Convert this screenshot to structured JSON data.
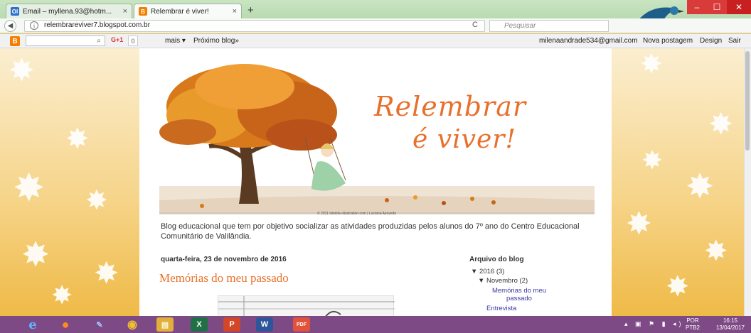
{
  "browser": {
    "tabs": [
      {
        "label": "Email – myllena.93@hotm...",
        "close": "×",
        "favicon": "Ol",
        "favicon_color": "#2a6fc9"
      },
      {
        "label": "Relembrar é viver!",
        "close": "×",
        "favicon": "B",
        "favicon_color": "#f57d00"
      }
    ],
    "new_tab": "+",
    "url": "relembrareviver7.blogspot.com.br",
    "search_placeholder": "Pesquisar",
    "window_controls": {
      "minimize": "–",
      "maximize": "☐",
      "close": "✕"
    }
  },
  "blogger_bar": {
    "logo": "B",
    "gplus": "G+1",
    "gplus_count": "0",
    "more": "mais ▾",
    "next_blog": "Próximo blog»",
    "email": "milenaandrade534@gmail.com",
    "new_post": "Nova postagem",
    "design": "Design",
    "sign_out": "Sair"
  },
  "blog": {
    "title_line1": "Relembrar",
    "title_line2": "é viver!",
    "art_credit": "© 2011 Isleilolu-illustration.com | Luciana Azevedo",
    "description": "Blog educacional que tem por objetivo socializar as atividades produzidas pelos alunos do 7º ano do Centro Educacional Comunitário de Valilândia.",
    "post_date": "quarta-feira, 23 de novembro de 2016",
    "post_title": "Memórias do meu passado"
  },
  "archive": {
    "title": "Arquivo do blog",
    "year": "▼ 2016 (3)",
    "month": "▼ Novembro (2)",
    "posts": [
      "Memórias do meu passado",
      "Entrevista"
    ]
  },
  "taskbar": {
    "apps": [
      {
        "name": "ie-icon",
        "glyph": "e",
        "color": "#2b7fd6"
      },
      {
        "name": "firefox-icon",
        "glyph": "●",
        "color": "#e66000"
      },
      {
        "name": "paint-icon",
        "glyph": "✎",
        "color": "#5a8fd8"
      },
      {
        "name": "chrome-icon",
        "glyph": "◉",
        "color": "#3aa757"
      },
      {
        "name": "file-explorer-icon",
        "glyph": "▤",
        "color": "#e0b03a"
      },
      {
        "name": "excel-icon",
        "glyph": "X",
        "color": "#1e7145"
      },
      {
        "name": "powerpoint-icon",
        "glyph": "P",
        "color": "#d24726"
      },
      {
        "name": "word-icon",
        "glyph": "W",
        "color": "#2b579a"
      },
      {
        "name": "pdf-icon",
        "glyph": "PDF",
        "color": "#e0533a"
      }
    ],
    "lang_top": "POR",
    "lang_bottom": "PTB2",
    "time": "16:15",
    "date": "13/04/2017"
  }
}
